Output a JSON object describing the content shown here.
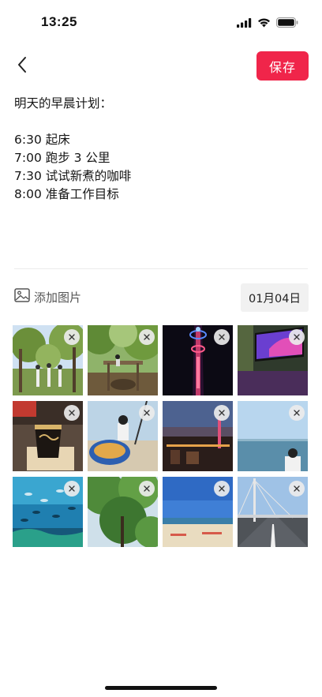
{
  "status_bar": {
    "time": "13:25"
  },
  "toolbar": {
    "save_label": "保存"
  },
  "note": {
    "title_line": "明天的早晨计划：",
    "lines": [
      "6:30 起床",
      "7:00 跑步 3 公里",
      "7:30 试试新煮的咖啡",
      "8:00 准备工作目标"
    ]
  },
  "attachments": {
    "add_label": "添加图片",
    "date": "01月04日",
    "photos": [
      {
        "subject": "trees-people"
      },
      {
        "subject": "playground-trees"
      },
      {
        "subject": "tower-night-lights"
      },
      {
        "subject": "screen-display"
      },
      {
        "subject": "coffee-cup"
      },
      {
        "subject": "swing-person"
      },
      {
        "subject": "coast-dusk"
      },
      {
        "subject": "sea-person"
      },
      {
        "subject": "aquarium-fish"
      },
      {
        "subject": "tree-canopy"
      },
      {
        "subject": "beach-sky"
      },
      {
        "subject": "bridge-road"
      }
    ]
  },
  "icons": {
    "back": "chevron-left-icon",
    "add_image": "image-icon",
    "remove": "close-icon",
    "signal": "signal-icon",
    "wifi": "wifi-icon",
    "battery": "battery-icon"
  },
  "colors": {
    "accent": "#f0254a"
  }
}
